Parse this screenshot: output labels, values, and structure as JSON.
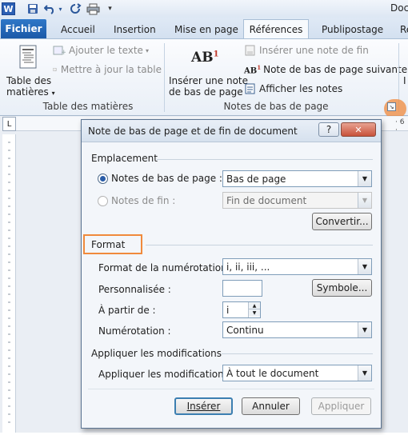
{
  "window": {
    "title": "Doc"
  },
  "quick_access": {
    "icons": [
      "word-logo-icon",
      "save-icon",
      "undo-icon",
      "undo-dropdown-icon",
      "redo-icon",
      "print-icon",
      "customize-icon"
    ]
  },
  "tabs": [
    "Fichier",
    "Accueil",
    "Insertion",
    "Mise en page",
    "Références",
    "Publipostage",
    "Ré"
  ],
  "active_tab": "Références",
  "ribbon": {
    "toc_group": {
      "label": "Table des matières",
      "toc_button": [
        "Table des",
        "matières"
      ],
      "add_text": "Ajouter le texte",
      "update_table": "Mettre à jour la table"
    },
    "footnotes_group": {
      "label": "Notes de bas de page",
      "insert_footnote": [
        "Insérer une note",
        "de bas de page"
      ],
      "insert_endnote": "Insérer une note de fin",
      "next_footnote": "Note de bas de page suivante",
      "show_notes": "Afficher les notes",
      "ab_glyph": "AB",
      "ab_sup": "1"
    },
    "next_group_peek": "I"
  },
  "dialog": {
    "title": "Note de bas de page et de fin de document",
    "help": "?",
    "close": "✕",
    "location": {
      "header": "Emplacement",
      "footnotes_label": "Notes de bas de page :",
      "footnotes_value": "Bas de page",
      "endnotes_label": "Notes de fin :",
      "endnotes_value": "Fin de document",
      "convert": "Convertir..."
    },
    "format": {
      "header": "Format",
      "number_format_label": "Format de la numérotation :",
      "number_format_value": "i, ii, iii, ...",
      "custom_label": "Personnalisée :",
      "custom_value": "",
      "symbol": "Symbole...",
      "start_at_label": "À partir de :",
      "start_at_value": "i",
      "numbering_label": "Numérotation :",
      "numbering_value": "Continu"
    },
    "apply": {
      "header": "Appliquer les modifications",
      "apply_label": "Appliquer les modifications à :",
      "apply_value": "À tout le document"
    },
    "buttons": {
      "insert": "Insérer",
      "cancel": "Annuler",
      "apply": "Appliquer"
    }
  },
  "colors": {
    "highlight": "#f08a3c",
    "file_tab": "#2a6ab8",
    "accent": "#2b579a"
  }
}
